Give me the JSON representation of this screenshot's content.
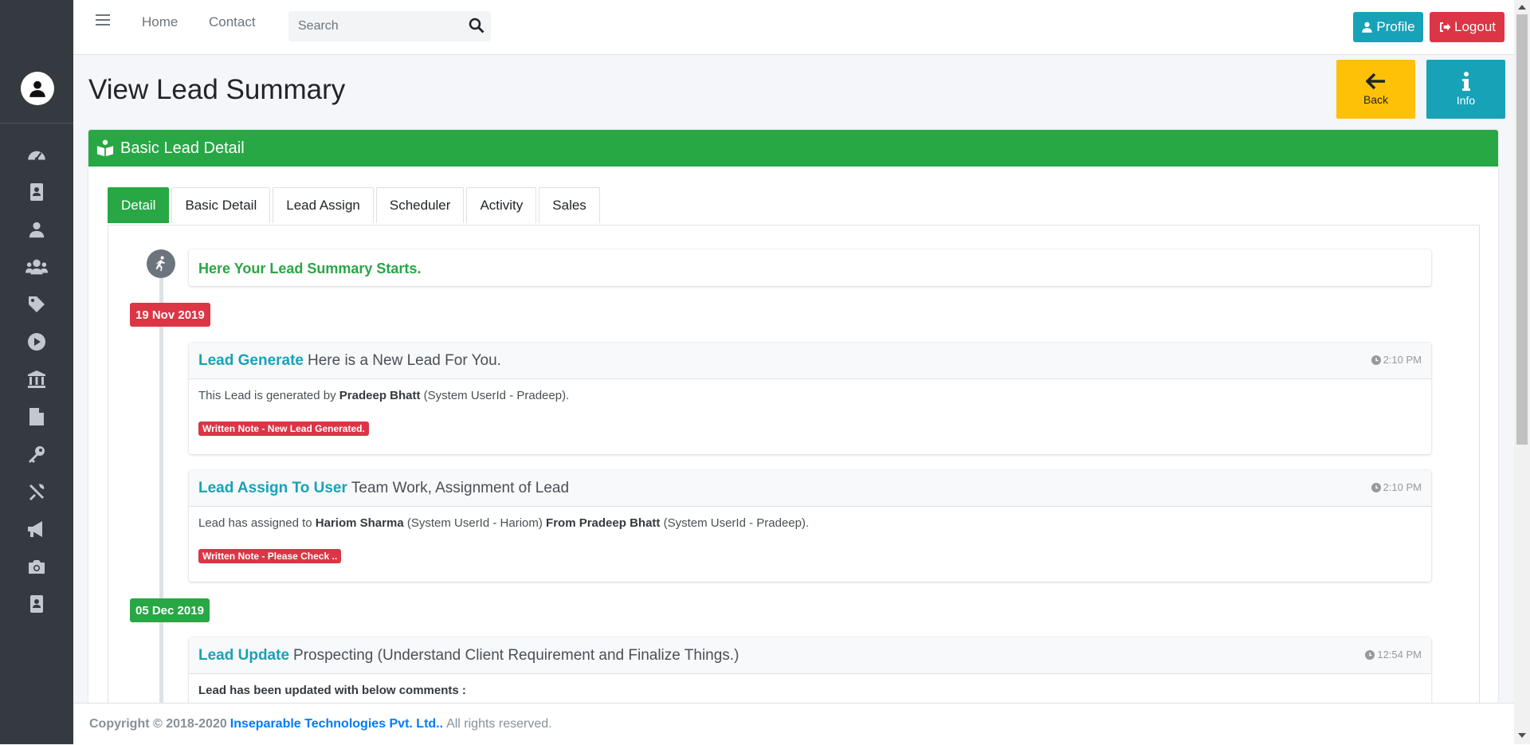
{
  "topbar": {
    "nav_links": [
      "Home",
      "Contact"
    ],
    "search_placeholder": "Search",
    "profile_label": "Profile",
    "logout_label": "Logout"
  },
  "sidebar": {
    "icons": [
      "dashboard-icon",
      "address-book-icon",
      "user-icon",
      "users-icon",
      "tag-icon",
      "play-circle-icon",
      "bank-icon",
      "file-icon",
      "key-icon",
      "tools-icon",
      "bullhorn-icon",
      "camera-icon",
      "contact-card-icon"
    ]
  },
  "header": {
    "title": "View Lead Summary",
    "back_label": "Back",
    "info_label": "Info"
  },
  "card": {
    "title": "Basic Lead Detail",
    "tabs": [
      "Detail",
      "Basic Detail",
      "Lead Assign",
      "Scheduler",
      "Activity",
      "Sales"
    ],
    "active_tab": "Detail"
  },
  "timeline": {
    "start_text": "Here Your Lead Summary Starts.",
    "date1": "19 Nov 2019",
    "date2": "05 Dec 2019",
    "items": [
      {
        "title": "Lead Generate",
        "subtitle": "Here is a New Lead For You.",
        "time": "2:10 PM",
        "body_pre": "This Lead is generated by",
        "body_name": "Pradeep Bhatt",
        "body_post": "(System UserId - Pradeep).",
        "note": "Written Note - New Lead Generated."
      },
      {
        "title": "Lead Assign To User",
        "subtitle": "Team Work, Assignment of Lead",
        "time": "2:10 PM",
        "body_pre": "Lead has assigned to",
        "body_name": "Hariom Sharma",
        "body_mid": "(System UserId - Hariom)",
        "body_from": "From Pradeep Bhatt",
        "body_post": "(System UserId - Pradeep).",
        "note": "Written Note - Please Check .."
      },
      {
        "title": "Lead Update",
        "subtitle": "Prospecting (Understand Client Requirement and Finalize Things.)",
        "time": "12:54 PM",
        "body_bold": "Lead has been updated with below comments :"
      }
    ]
  },
  "footer": {
    "prefix": "Copyright © 2018-2020",
    "company": "Inseparable Technologies Pvt. Ltd..",
    "suffix": "All rights reserved."
  },
  "colors": {
    "green": "#28a745",
    "teal": "#17a2b8",
    "red": "#dc3545",
    "yellow": "#ffc107",
    "sidebar": "#343a40"
  }
}
